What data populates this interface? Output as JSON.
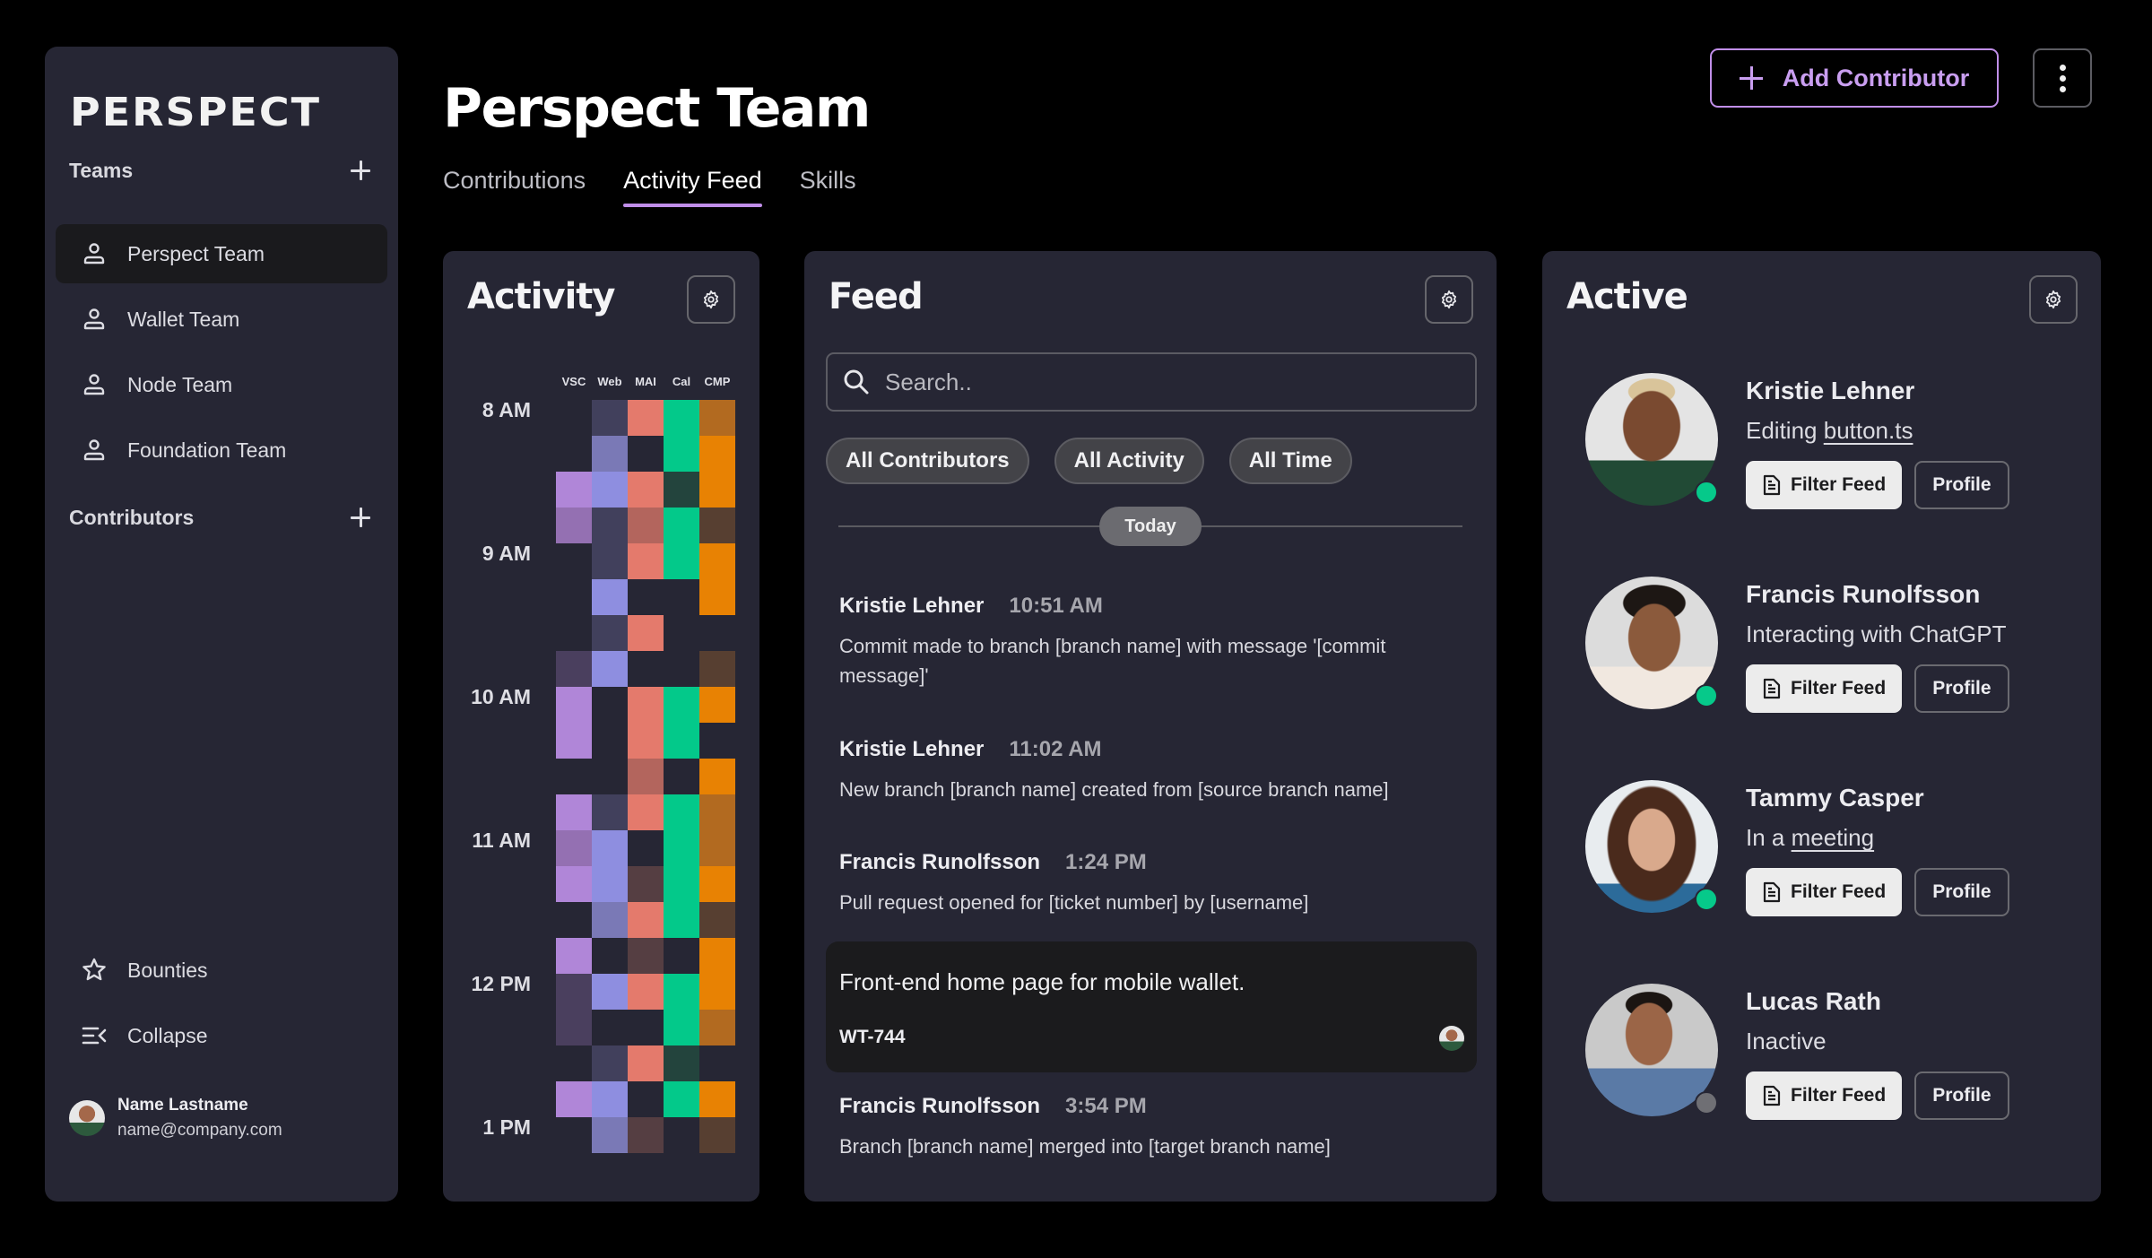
{
  "sidebar": {
    "logo": "PERSPECT",
    "teams_header": "Teams",
    "teams": [
      {
        "label": "Perspect Team",
        "active": true
      },
      {
        "label": "Wallet Team",
        "active": false
      },
      {
        "label": "Node Team",
        "active": false
      },
      {
        "label": "Foundation Team",
        "active": false
      }
    ],
    "contributors_header": "Contributors",
    "bottom_items": [
      {
        "label": "Bounties",
        "icon": "star-icon"
      },
      {
        "label": "Collapse",
        "icon": "collapse-icon"
      }
    ],
    "user": {
      "name": "Name Lastname",
      "email": "name@company.com"
    }
  },
  "header": {
    "title": "Perspect Team",
    "tabs": [
      {
        "label": "Contributions",
        "active": false
      },
      {
        "label": "Activity Feed",
        "active": true
      },
      {
        "label": "Skills",
        "active": false
      }
    ],
    "add_contributor_label": "Add Contributor",
    "accent_color": "#c08ee8"
  },
  "activity": {
    "title": "Activity",
    "columns": [
      "VSC",
      "Web",
      "MAI",
      "Cal",
      "CMP"
    ],
    "time_labels": [
      "8 AM",
      "9 AM",
      "10 AM",
      "11 AM",
      "12 PM",
      "1 PM"
    ],
    "slot_minutes": 15,
    "palette": {
      "VSC": [
        "#4a3f5e",
        "#9470b2",
        "#b086d8"
      ],
      "Web": [
        "#41405c",
        "#7a79b6",
        "#8e8ee0"
      ],
      "MAI": [
        "#553e42",
        "#b3655d",
        "#e47a6c"
      ],
      "Cal": [
        "#23443d",
        "#16a374",
        "#03c98a"
      ],
      "CMP": [
        "#573f31",
        "#b26a20",
        "#e88203"
      ]
    },
    "chart_data": {
      "type": "heatmap",
      "title": "Activity",
      "x": [
        "VSC",
        "Web",
        "MAI",
        "Cal",
        "CMP"
      ],
      "y_start": "7:45 AM",
      "y_step_minutes": 15,
      "y_tick_labels": [
        "8 AM",
        "9 AM",
        "10 AM",
        "11 AM",
        "12 PM",
        "1 PM"
      ],
      "value_scale": "0 = none, 1 = low, 2 = medium, 3 = high",
      "values": [
        [
          0,
          1,
          3,
          3,
          2
        ],
        [
          0,
          2,
          0,
          3,
          3
        ],
        [
          3,
          3,
          3,
          1,
          3
        ],
        [
          2,
          1,
          2,
          3,
          1
        ],
        [
          0,
          1,
          3,
          3,
          3
        ],
        [
          0,
          3,
          0,
          0,
          3
        ],
        [
          0,
          1,
          3,
          0,
          0
        ],
        [
          1,
          3,
          0,
          0,
          1
        ],
        [
          3,
          0,
          3,
          3,
          3
        ],
        [
          3,
          0,
          3,
          3,
          0
        ],
        [
          0,
          0,
          2,
          0,
          3
        ],
        [
          3,
          1,
          3,
          3,
          2
        ],
        [
          2,
          3,
          0,
          3,
          2
        ],
        [
          3,
          3,
          1,
          3,
          3
        ],
        [
          0,
          2,
          3,
          3,
          1
        ],
        [
          3,
          0,
          1,
          0,
          3
        ],
        [
          1,
          3,
          3,
          3,
          3
        ],
        [
          1,
          0,
          0,
          3,
          2
        ],
        [
          0,
          1,
          3,
          1,
          0
        ],
        [
          3,
          3,
          0,
          3,
          3
        ],
        [
          0,
          2,
          1,
          0,
          1
        ]
      ]
    }
  },
  "feed": {
    "title": "Feed",
    "search_placeholder": "Search..",
    "filters": [
      "All Contributors",
      "All Activity",
      "All Time"
    ],
    "day_divider": "Today",
    "items": [
      {
        "author": "Kristie Lehner",
        "time": "10:51 AM",
        "text": "Commit made to branch [branch name] with message '[commit message]'"
      },
      {
        "author": "Kristie Lehner",
        "time": "11:02 AM",
        "text": "New branch [branch name] created from [source branch name]"
      },
      {
        "author": "Francis Runolfsson",
        "time": "1:24 PM",
        "text": "Pull request opened for [ticket number] by [username]"
      },
      {
        "author": "Francis Runolfsson",
        "time": "3:54 PM",
        "text": "Branch [branch name] merged into [target branch name]"
      }
    ],
    "ticket": {
      "title": "Front-end home page for mobile wallet.",
      "id": "WT-744"
    }
  },
  "active": {
    "title": "Active",
    "filter_label": "Filter Feed",
    "profile_label": "Profile",
    "online_color": "#06c98a",
    "offline_color": "#6f6f74",
    "members": [
      {
        "name": "Kristie Lehner",
        "status_prefix": "Editing ",
        "status_link": "button.ts",
        "online": true
      },
      {
        "name": "Francis Runolfsson",
        "status_prefix": "Interacting with ChatGPT",
        "status_link": "",
        "online": true
      },
      {
        "name": "Tammy Casper",
        "status_prefix": "In a ",
        "status_link": "meeting",
        "online": true
      },
      {
        "name": "Lucas Rath",
        "status_prefix": "Inactive",
        "status_link": "",
        "online": false
      }
    ]
  }
}
